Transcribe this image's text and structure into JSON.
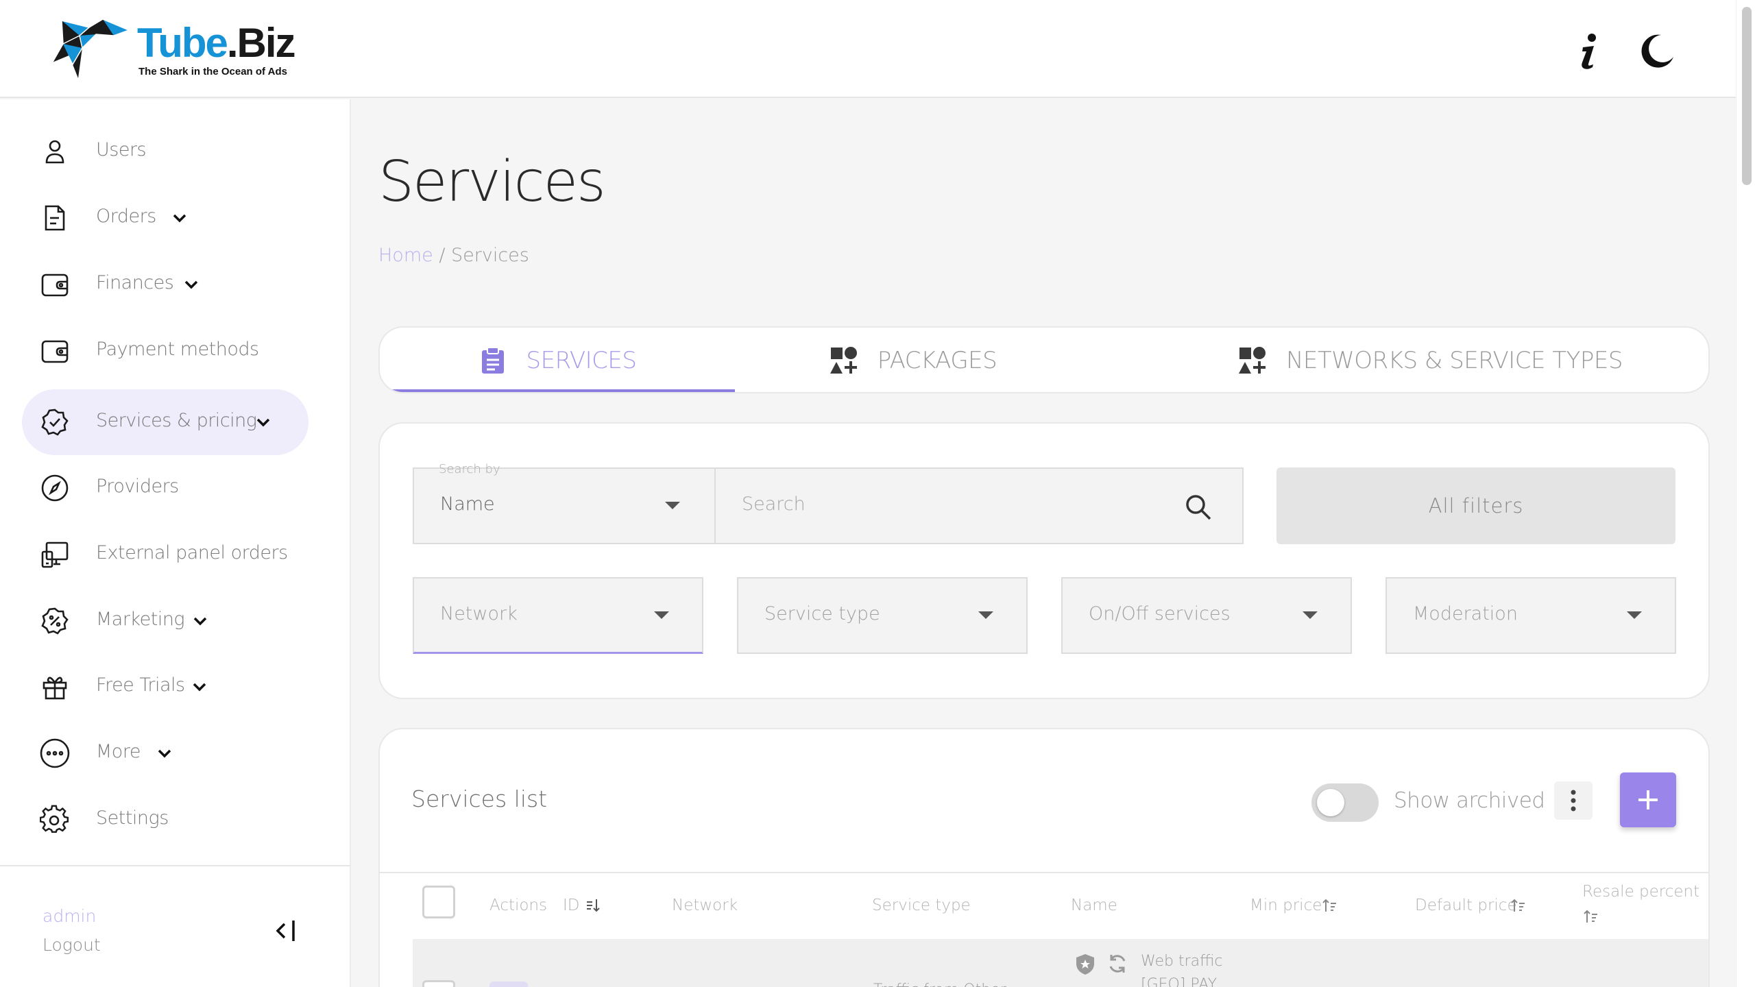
{
  "brand": {
    "name_part1": "Tube",
    "name_part2": ".Biz",
    "tagline": "The Shark in the Ocean of Ads",
    "colors": {
      "blue": "#1593d6",
      "accent": "#8b7de0"
    }
  },
  "header": {
    "info_icon": "info-icon",
    "theme_icon": "moon-icon"
  },
  "sidebar": {
    "items": [
      {
        "label": "Users",
        "icon": "user-icon",
        "has_chevron": false
      },
      {
        "label": "Orders",
        "icon": "document-icon",
        "has_chevron": true
      },
      {
        "label": "Finances",
        "icon": "wallet-icon",
        "has_chevron": true
      },
      {
        "label": "Payment methods",
        "icon": "wallet-icon",
        "has_chevron": false
      },
      {
        "label": "Services & pricing",
        "icon": "badge-check-icon",
        "has_chevron": true,
        "active": true
      },
      {
        "label": "Providers",
        "icon": "compass-icon",
        "has_chevron": false
      },
      {
        "label": "External panel orders",
        "icon": "devices-icon",
        "has_chevron": false
      },
      {
        "label": "Marketing",
        "icon": "discount-icon",
        "has_chevron": true
      },
      {
        "label": "Free Trials",
        "icon": "gift-icon",
        "has_chevron": true
      },
      {
        "label": "More",
        "icon": "more-circle-icon",
        "has_chevron": true
      },
      {
        "label": "Settings",
        "icon": "gear-icon",
        "has_chevron": false
      }
    ],
    "user": "admin",
    "logout": "Logout"
  },
  "page": {
    "title": "Services",
    "breadcrumb_home": "Home",
    "breadcrumb_sep": " / ",
    "breadcrumb_current": "Services"
  },
  "tabs": [
    {
      "label": "SERVICES",
      "icon": "clipboard-icon",
      "active": true
    },
    {
      "label": "PACKAGES",
      "icon": "shapes-icon",
      "active": false
    },
    {
      "label": "NETWORKS & SERVICE TYPES",
      "icon": "shapes-icon",
      "active": false
    }
  ],
  "filters": {
    "search_by_caption": "Search by",
    "search_by_value": "Name",
    "search_placeholder": "Search",
    "all_filters": "All filters",
    "network": "Network",
    "service_type": "Service type",
    "on_off": "On/Off services",
    "moderation": "Moderation"
  },
  "list": {
    "title": "Services list",
    "show_archived": "Show archived",
    "show_archived_on": false,
    "columns": [
      "Actions",
      "ID",
      "Network",
      "Service type",
      "Name",
      "Min price",
      "Default price",
      "Resale percent"
    ],
    "first_row": {
      "service_type": "Traffic from Other",
      "name_line1": "Web traffic",
      "name_line2": "[GEO] PAY"
    }
  }
}
